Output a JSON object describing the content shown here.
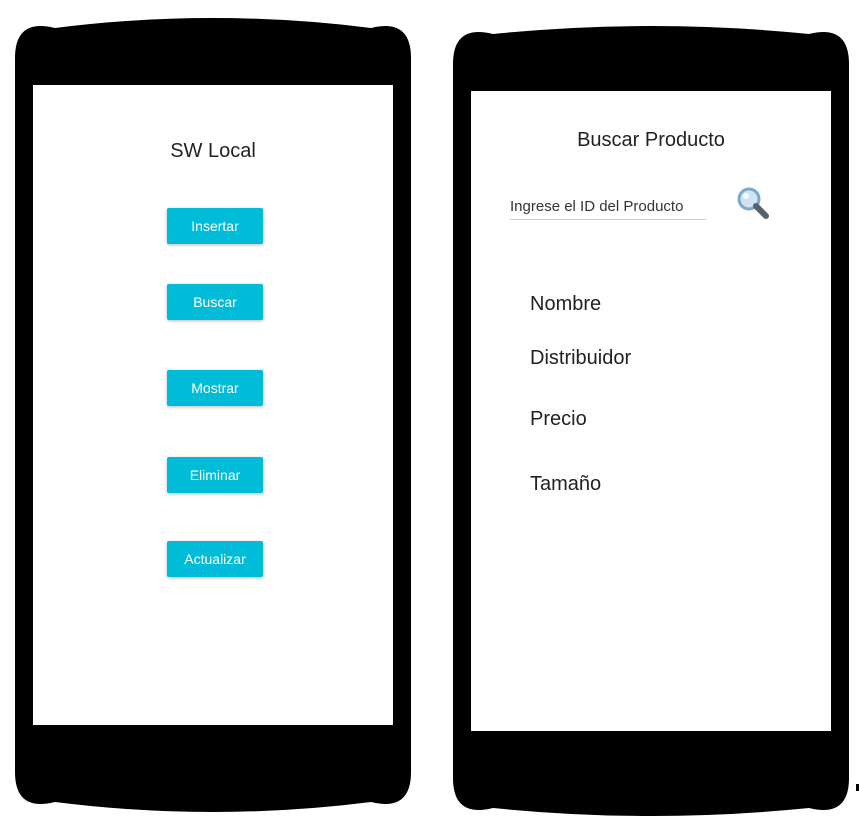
{
  "left_screen": {
    "title": "SW Local",
    "buttons": [
      {
        "label": "Insertar"
      },
      {
        "label": "Buscar"
      },
      {
        "label": "Mostrar"
      },
      {
        "label": "Eliminar"
      },
      {
        "label": "Actualizar"
      }
    ]
  },
  "right_screen": {
    "title": "Buscar Producto",
    "search": {
      "placeholder": "Ingrese el ID del Producto",
      "icon": "magnifier-icon"
    },
    "fields": [
      {
        "label": "Nombre"
      },
      {
        "label": "Distribuidor"
      },
      {
        "label": "Precio"
      },
      {
        "label": "Tamaño"
      }
    ]
  },
  "colors": {
    "accent": "#00bcd8",
    "phone_frame": "#000000",
    "screen_bg": "#ffffff"
  }
}
